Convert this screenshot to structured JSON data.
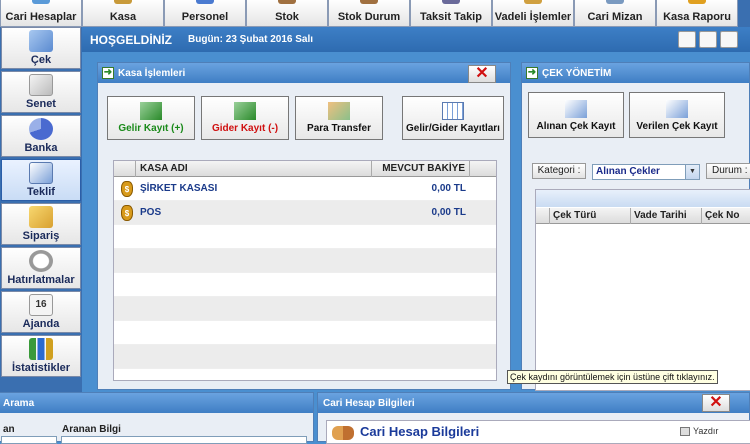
{
  "topnav": [
    {
      "label": "Cari Hesaplar"
    },
    {
      "label": "Kasa"
    },
    {
      "label": "Personel"
    },
    {
      "label": "Stok"
    },
    {
      "label": "Stok Durum"
    },
    {
      "label": "Taksit Takip"
    },
    {
      "label": "Vadeli İşlemler"
    },
    {
      "label": "Cari Mizan"
    },
    {
      "label": "Kasa Raporu"
    }
  ],
  "sidebar": [
    {
      "label": "Çek"
    },
    {
      "label": "Senet"
    },
    {
      "label": "Banka"
    },
    {
      "label": "Teklif"
    },
    {
      "label": "Sipariş"
    },
    {
      "label": "Hatırlatmalar"
    },
    {
      "label": "Ajanda",
      "icon_number": "16"
    },
    {
      "label": "İstatistikler"
    }
  ],
  "welcome": {
    "greeting": "HOŞGELDİNİZ",
    "date": "Bugün: 23 Şubat 2016 Salı"
  },
  "kasa_window": {
    "title": "Kasa İşlemleri",
    "close": "✕",
    "buttons": {
      "gelir": "Gelir Kayıt (+)",
      "gider": "Gider Kayıt (-)",
      "transfer": "Para Transfer",
      "kayitlar": "Gelir/Gider Kayıtları"
    },
    "columns": {
      "name": "KASA ADI",
      "balance": "MEVCUT BAKİYE"
    },
    "rows": [
      {
        "name": "ŞİRKET KASASI",
        "balance": "0,00 TL"
      },
      {
        "name": "POS",
        "balance": "0,00 TL"
      }
    ]
  },
  "cek_window": {
    "title": "ÇEK YÖNETİM",
    "buttons": {
      "alinan": "Alınan Çek Kayıt",
      "verilen": "Verilen Çek Kayıt"
    },
    "kategori_label": "Kategori :",
    "kategori_value": "Alınan Çekler",
    "durum_label": "Durum :",
    "columns": {
      "tur": "Çek Türü",
      "vade": "Vade Tarihi",
      "no": "Çek No"
    }
  },
  "tooltip": "Çek kaydını görüntülemek için üstüne çift tıklayınız.",
  "arama_window": {
    "title": "Arama",
    "col1": "an",
    "col2": "Aranan Bilgi"
  },
  "cari_window": {
    "title": "Cari Hesap Bilgileri",
    "inner_title": "Cari Hesap Bilgileri",
    "print": "Yazdır",
    "close": "✕"
  },
  "colors": {
    "accent": "#3f7ec4",
    "gelir": "#1a8a1a",
    "gider": "#d01010",
    "link": "#1a3a8a"
  }
}
